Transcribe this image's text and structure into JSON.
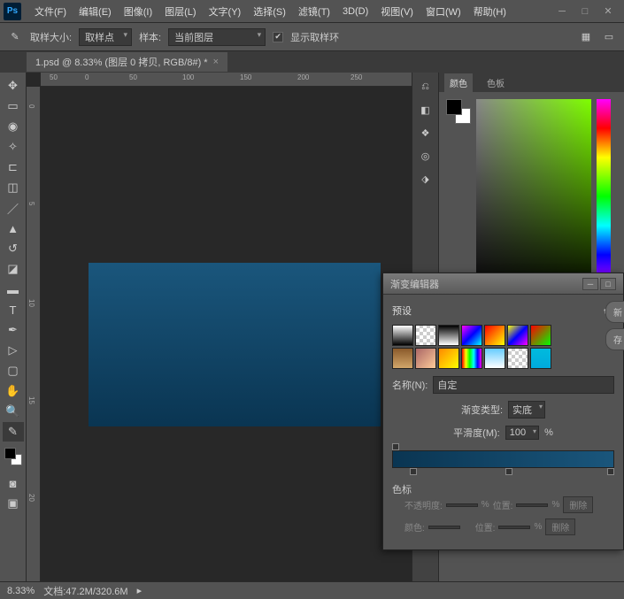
{
  "menu": [
    "文件(F)",
    "编辑(E)",
    "图像(I)",
    "图层(L)",
    "文字(Y)",
    "选择(S)",
    "滤镜(T)",
    "3D(D)",
    "视图(V)",
    "窗口(W)",
    "帮助(H)"
  ],
  "optbar": {
    "size_label": "取样大小:",
    "size_value": "取样点",
    "sample_label": "样本:",
    "sample_value": "当前图层",
    "ring_label": "显示取样环"
  },
  "doc_tab": "1.psd @ 8.33% (图层 0 拷贝, RGB/8#) *",
  "ruler_h": [
    "50",
    "0",
    "50",
    "100",
    "150",
    "200"
  ],
  "ruler_v": [
    "0",
    "5",
    "10",
    "15",
    "20"
  ],
  "panel": {
    "tab1": "颜色",
    "tab2": "色板"
  },
  "grad": {
    "title": "渐变编辑器",
    "presets_label": "预设",
    "name_label": "名称(N):",
    "name_value": "自定",
    "type_label": "渐变类型:",
    "type_value": "实底",
    "smooth_label": "平滑度(M):",
    "smooth_value": "100",
    "pct": "%",
    "stops_label": "色标",
    "opacity_label": "不透明度:",
    "position_label": "位置:",
    "color_label": "颜色:",
    "delete_btn": "删除"
  },
  "side": {
    "btn1": "新",
    "btn2": "存"
  },
  "status": {
    "zoom": "8.33%",
    "info": "文档:47.2M/320.6M"
  }
}
